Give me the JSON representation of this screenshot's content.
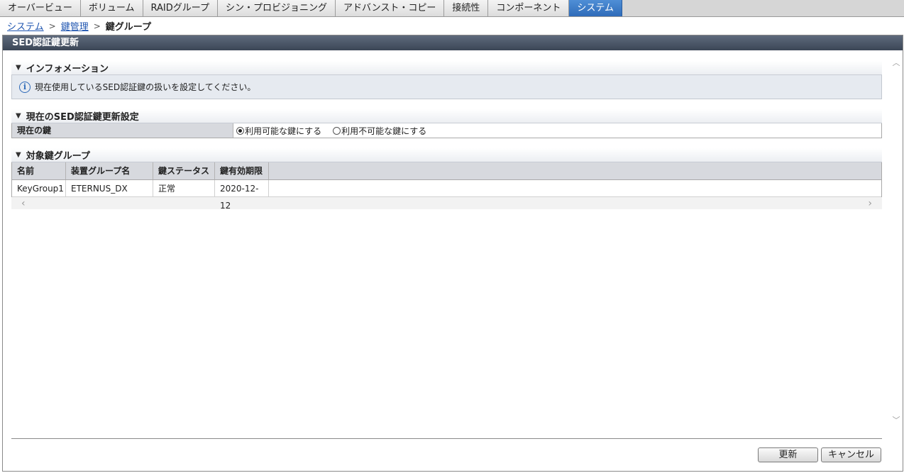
{
  "tabs": [
    {
      "label": "オーバービュー"
    },
    {
      "label": "ボリューム"
    },
    {
      "label": "RAIDグループ"
    },
    {
      "label": "シン・プロビジョニング"
    },
    {
      "label": "アドバンスト・コピー"
    },
    {
      "label": "接続性"
    },
    {
      "label": "コンポーネント"
    },
    {
      "label": "システム"
    }
  ],
  "breadcrumb": {
    "items": [
      "システム",
      "鍵管理"
    ],
    "separator": ">",
    "current": "鍵グループ"
  },
  "panel_title": "SED認証鍵更新",
  "info_section": {
    "title": "インフォメーション",
    "icon": "i",
    "message": "現在使用しているSED認証鍵の扱いを設定してください。"
  },
  "current_settings": {
    "title": "現在のSED認証鍵更新設定",
    "row_label": "現在の鍵",
    "options": [
      "利用可能な鍵にする",
      "利用不可能な鍵にする"
    ],
    "selected": 0
  },
  "key_group_section": {
    "title": "対象鍵グループ",
    "columns": [
      "名前",
      "装置グループ名",
      "鍵ステータス",
      "鍵有効期限"
    ],
    "rows": [
      [
        "KeyGroup1",
        "ETERNUS_DX",
        "正常",
        "2020-12-12"
      ]
    ]
  },
  "buttons": {
    "update": "更新",
    "cancel": "キャンセル"
  },
  "colors": {
    "active_tab": "#2f6bb9",
    "panel_header": "#3b4656",
    "link": "#1f55b0"
  }
}
